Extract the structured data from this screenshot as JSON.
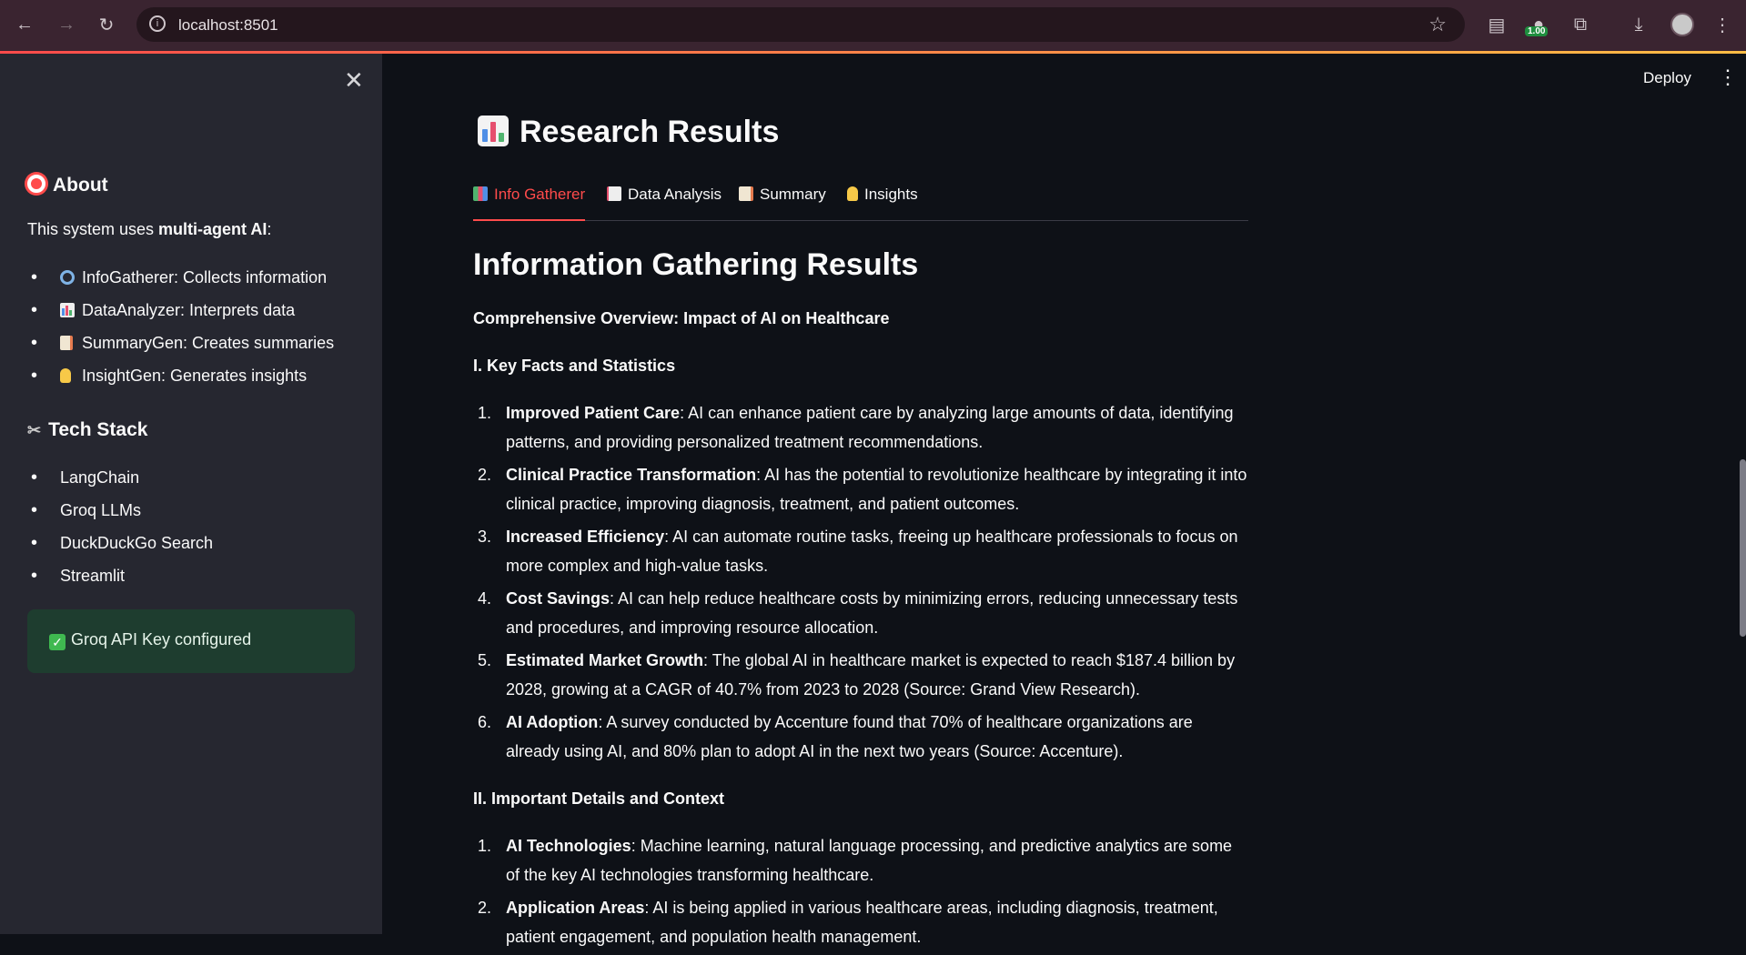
{
  "browser": {
    "url": "localhost:8501",
    "extension_badge": "1.00"
  },
  "sidebar": {
    "about_title": "About",
    "about_intro_prefix": "This system uses ",
    "about_intro_bold": "multi-agent AI",
    "about_intro_suffix": ":",
    "agents": [
      {
        "icon": "magnifier-icon",
        "label": "InfoGatherer: Collects information"
      },
      {
        "icon": "bar-chart-icon",
        "label": "DataAnalyzer: Interprets data"
      },
      {
        "icon": "memo-icon",
        "label": "SummaryGen: Creates summaries"
      },
      {
        "icon": "lightbulb-icon",
        "label": "InsightGen: Generates insights"
      }
    ],
    "tech_title": "Tech Stack",
    "tech_items": [
      "LangChain",
      "Groq LLMs",
      "DuckDuckGo Search",
      "Streamlit"
    ],
    "status_text": "Groq API Key configured"
  },
  "header": {
    "deploy_label": "Deploy"
  },
  "main": {
    "title": "Research Results",
    "tabs": [
      {
        "label": "Info Gatherer",
        "icon": "books-icon",
        "active": true
      },
      {
        "label": "Data Analysis",
        "icon": "chart-increasing-icon",
        "active": false
      },
      {
        "label": "Summary",
        "icon": "memo-icon",
        "active": false
      },
      {
        "label": "Insights",
        "icon": "lightbulb-icon",
        "active": false
      }
    ],
    "heading": "Information Gathering Results",
    "overview": "Comprehensive Overview: Impact of AI on Healthcare",
    "section1_title": "I. Key Facts and Statistics",
    "section1_items": [
      {
        "bold": "Improved Patient Care",
        "text": ": AI can enhance patient care by analyzing large amounts of data, identifying patterns, and providing personalized treatment recommendations."
      },
      {
        "bold": "Clinical Practice Transformation",
        "text": ": AI has the potential to revolutionize healthcare by integrating it into clinical practice, improving diagnosis, treatment, and patient outcomes."
      },
      {
        "bold": "Increased Efficiency",
        "text": ": AI can automate routine tasks, freeing up healthcare professionals to focus on more complex and high-value tasks."
      },
      {
        "bold": "Cost Savings",
        "text": ": AI can help reduce healthcare costs by minimizing errors, reducing unnecessary tests and procedures, and improving resource allocation."
      },
      {
        "bold": "Estimated Market Growth",
        "text": ": The global AI in healthcare market is expected to reach $187.4 billion by 2028, growing at a CAGR of 40.7% from 2023 to 2028 (Source: Grand View Research)."
      },
      {
        "bold": "AI Adoption",
        "text": ": A survey conducted by Accenture found that 70% of healthcare organizations are already using AI, and 80% plan to adopt AI in the next two years (Source: Accenture)."
      }
    ],
    "section2_title": "II. Important Details and Context",
    "section2_items": [
      {
        "bold": "AI Technologies",
        "text": ": Machine learning, natural language processing, and predictive analytics are some of the key AI technologies transforming healthcare."
      },
      {
        "bold": "Application Areas",
        "text": ": AI is being applied in various healthcare areas, including diagnosis, treatment, patient engagement, and population health management."
      }
    ]
  }
}
